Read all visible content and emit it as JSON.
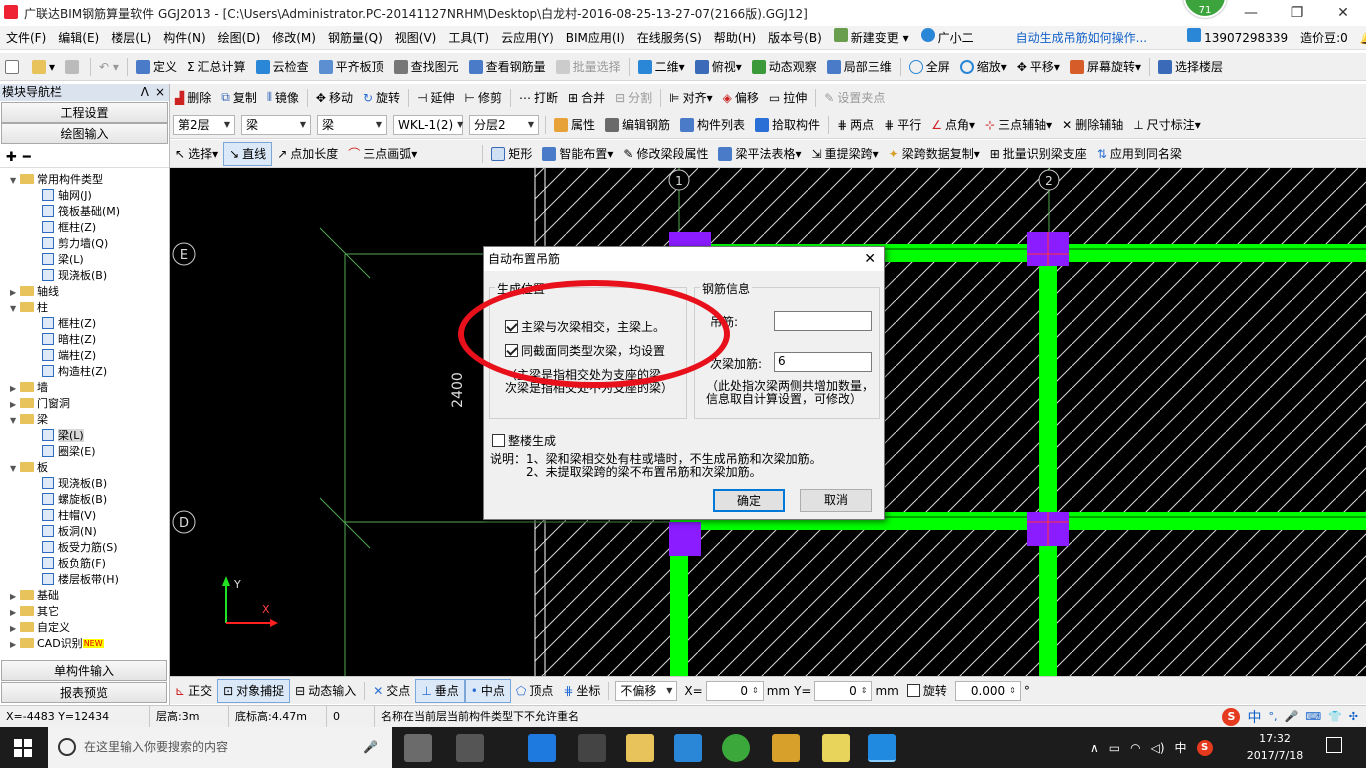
{
  "titlebar": {
    "title": "广联达BIM钢筋算量软件 GGJ2013 - [C:\\Users\\Administrator.PC-20141127NRHM\\Desktop\\白龙村-2016-08-25-13-27-07(2166版).GGJ12]",
    "badge": "71",
    "min": "—",
    "max": "❐",
    "close": "✕"
  },
  "menu": [
    "文件(F)",
    "编辑(E)",
    "楼层(L)",
    "构件(N)",
    "绘图(D)",
    "修改(M)",
    "钢筋量(Q)",
    "视图(V)",
    "工具(T)",
    "云应用(Y)",
    "BIM应用(I)",
    "在线服务(S)",
    "帮助(H)",
    "版本号(B)",
    "新建变更",
    "广小二",
    "自动生成吊筋如何操作...",
    "13907298339",
    "造价豆:0"
  ],
  "toolbar1": [
    "定义",
    "汇总计算",
    "云检查",
    "平齐板顶",
    "查找图元",
    "查看钢筋量",
    "批量选择",
    "二维",
    "俯视",
    "动态观察",
    "局部三维",
    "全屏",
    "缩放",
    "平移",
    "屏幕旋转",
    "选择楼层"
  ],
  "toolbar2": [
    "删除",
    "复制",
    "镜像",
    "移动",
    "旋转",
    "延伸",
    "修剪",
    "打断",
    "合并",
    "分割",
    "对齐",
    "偏移",
    "拉伸",
    "设置夹点"
  ],
  "toolbar3": {
    "floor": "第2层",
    "type1": "梁",
    "type2": "梁",
    "member": "WKL-1(2)",
    "layer": "分层2",
    "buttons": [
      "属性",
      "编辑钢筋",
      "构件列表",
      "拾取构件",
      "两点",
      "平行",
      "点角",
      "三点辅轴",
      "删除辅轴",
      "尺寸标注"
    ]
  },
  "toolbar4": [
    "选择",
    "直线",
    "点加长度",
    "三点画弧",
    "矩形",
    "智能布置",
    "修改梁段属性",
    "梁平法表格",
    "重提梁跨",
    "梁跨数据复制",
    "批量识别梁支座",
    "应用到同名梁"
  ],
  "leftpanel": {
    "header": "模块导航栏",
    "pin": "ᐱ",
    "close": "×",
    "btn_top1": "工程设置",
    "btn_top2": "绘图输入",
    "btn_bot1": "单构件输入",
    "btn_bot2": "报表预览"
  },
  "tree": [
    {
      "t": "常用构件类型",
      "lvl": 0,
      "exp": "▼",
      "folder": true
    },
    {
      "t": "轴网(J)",
      "lvl": 1
    },
    {
      "t": "筏板基础(M)",
      "lvl": 1
    },
    {
      "t": "框柱(Z)",
      "lvl": 1
    },
    {
      "t": "剪力墙(Q)",
      "lvl": 1
    },
    {
      "t": "梁(L)",
      "lvl": 1
    },
    {
      "t": "现浇板(B)",
      "lvl": 1
    },
    {
      "t": "轴线",
      "lvl": 0,
      "exp": "▶",
      "folder": true
    },
    {
      "t": "柱",
      "lvl": 0,
      "exp": "▼",
      "folder": true
    },
    {
      "t": "框柱(Z)",
      "lvl": 1
    },
    {
      "t": "暗柱(Z)",
      "lvl": 1
    },
    {
      "t": "端柱(Z)",
      "lvl": 1
    },
    {
      "t": "构造柱(Z)",
      "lvl": 1
    },
    {
      "t": "墙",
      "lvl": 0,
      "exp": "▶",
      "folder": true
    },
    {
      "t": "门窗洞",
      "lvl": 0,
      "exp": "▶",
      "folder": true
    },
    {
      "t": "梁",
      "lvl": 0,
      "exp": "▼",
      "folder": true
    },
    {
      "t": "梁(L)",
      "lvl": 1,
      "sel": true
    },
    {
      "t": "圈梁(E)",
      "lvl": 1
    },
    {
      "t": "板",
      "lvl": 0,
      "exp": "▼",
      "folder": true
    },
    {
      "t": "现浇板(B)",
      "lvl": 1
    },
    {
      "t": "螺旋板(B)",
      "lvl": 1
    },
    {
      "t": "柱帽(V)",
      "lvl": 1
    },
    {
      "t": "板洞(N)",
      "lvl": 1
    },
    {
      "t": "板受力筋(S)",
      "lvl": 1
    },
    {
      "t": "板负筋(F)",
      "lvl": 1
    },
    {
      "t": "楼层板带(H)",
      "lvl": 1
    },
    {
      "t": "基础",
      "lvl": 0,
      "exp": "▶",
      "folder": true
    },
    {
      "t": "其它",
      "lvl": 0,
      "exp": "▶",
      "folder": true
    },
    {
      "t": "自定义",
      "lvl": 0,
      "exp": "▶",
      "folder": true
    },
    {
      "t": "CAD识别",
      "lvl": 0,
      "exp": "▶",
      "folder": true,
      "new": "NEW"
    }
  ],
  "canvas": {
    "axis_e": "E",
    "axis_d": "D",
    "axis_1": "1",
    "axis_2": "2",
    "dim": "2400",
    "y": "Y",
    "x": "X"
  },
  "dialog": {
    "title": "自动布置吊筋",
    "close": "✕",
    "group1": "生成位置",
    "cb1": "主梁与次梁相交，主梁上。",
    "cb2": "同截面同类型次梁，均设置",
    "note1a": "（主梁是指相交处为支座的梁。",
    "note1b": "次梁是指相交处不为支座的梁）",
    "group2": "钢筋信息",
    "label_hanger": "吊筋:",
    "hanger_value": "",
    "label_extra": "次梁加筋:",
    "extra_value": "6",
    "note2a": "（此处指次梁两侧共增加数量，",
    "note2b": "信息取自计算设置，可修改）",
    "cb3": "整楼生成",
    "explain_label": "说明：",
    "explain1": "1、梁和梁相交处有柱或墙时，不生成吊筋和次梁加筋。",
    "explain2": "2、未提取梁跨的梁不布置吊筋和次梁加筋。",
    "ok": "确定",
    "cancel": "取消"
  },
  "statusbar2": {
    "items": [
      "正交",
      "对象捕捉",
      "动态输入",
      "交点",
      "垂点",
      "中点",
      "顶点",
      "坐标"
    ],
    "offset": "不偏移",
    "x_label": "X=",
    "x_val": "0",
    "y_label": "Y=",
    "y_val": "0",
    "unit": "mm",
    "rot_label": "旋转",
    "rot_val": "0.000",
    "deg": "°"
  },
  "statusbar": {
    "coord": "X=-4483 Y=12434",
    "height": "层高:3m",
    "base": "底标高:4.47m",
    "num": "0",
    "msg": "名称在当前层当前构件类型下不允许重名"
  },
  "taskbar": {
    "search": "在这里输入你要搜索的内容",
    "time": "17:32",
    "date": "2017/7/18",
    "ime": "中",
    "ime2": "中"
  },
  "colors": {
    "beam": "#00ff00",
    "column": "#8a1cff",
    "canvas_bg": "#000000",
    "highlight": "#e8101a"
  }
}
